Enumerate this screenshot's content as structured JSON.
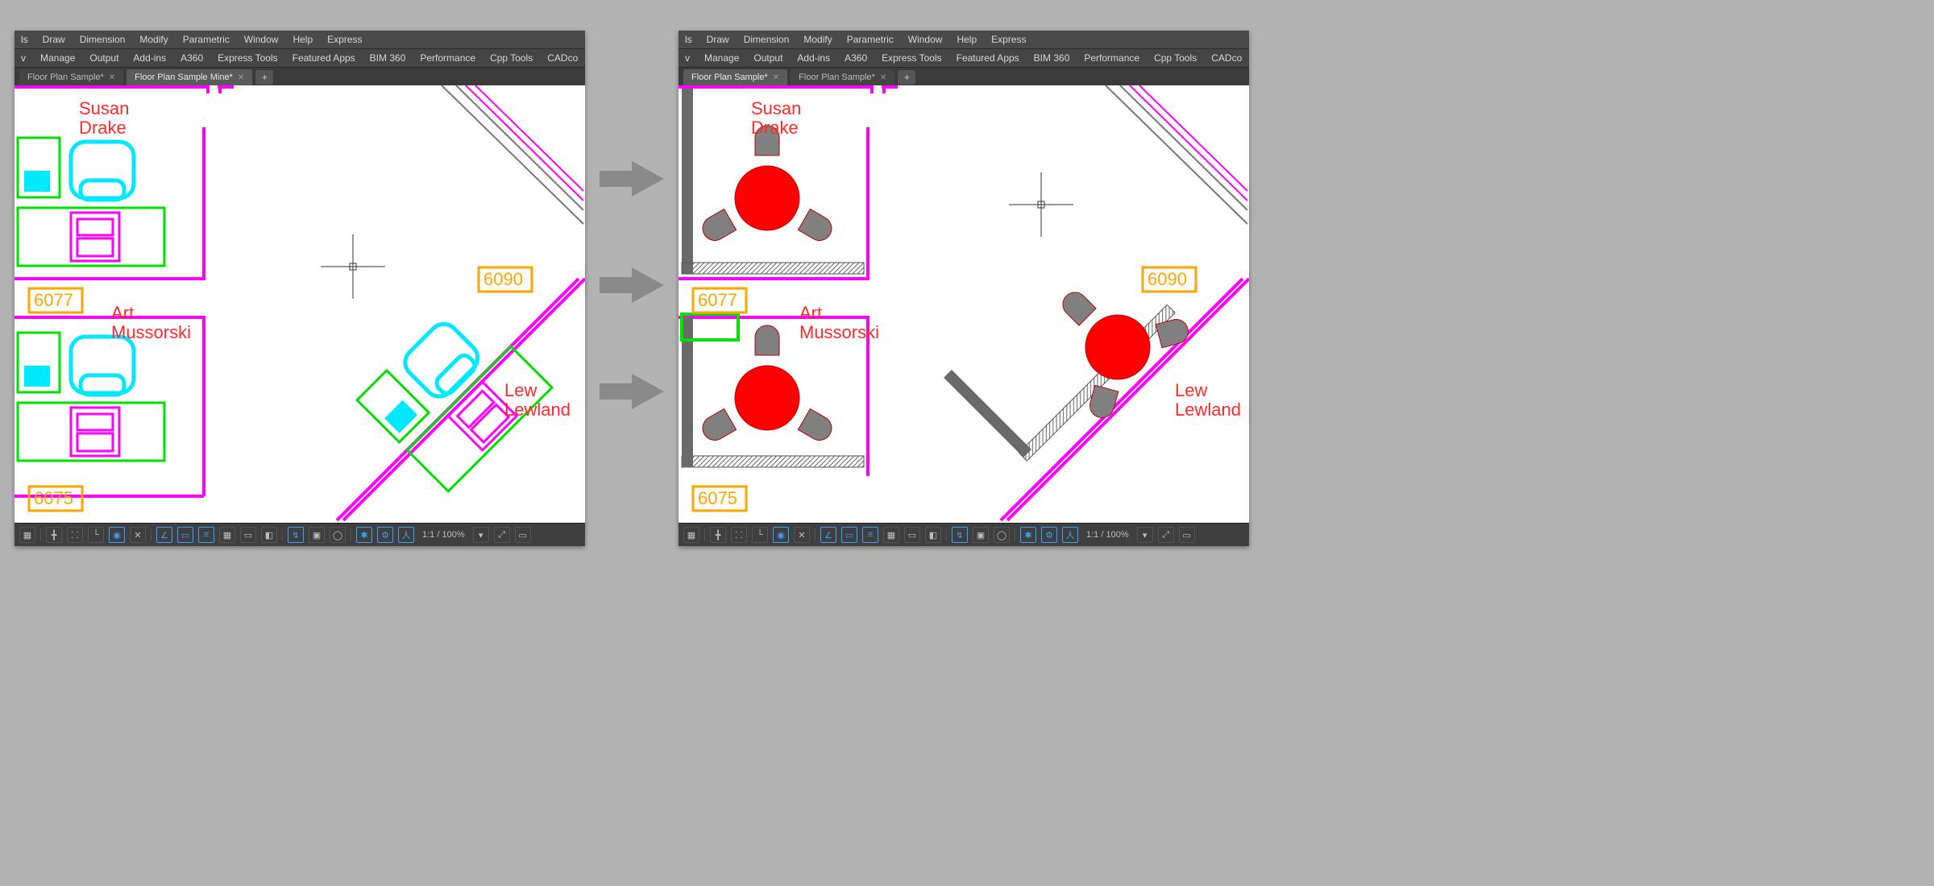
{
  "menus": {
    "top": [
      "ls",
      "Draw",
      "Dimension",
      "Modify",
      "Parametric",
      "Window",
      "Help",
      "Express"
    ],
    "ribbon": [
      "v",
      "Manage",
      "Output",
      "Add-ins",
      "A360",
      "Express Tools",
      "Featured Apps",
      "BIM 360",
      "Performance",
      "Cpp Tools",
      "CADco"
    ]
  },
  "left": {
    "tabs": [
      {
        "label": "Floor Plan Sample*",
        "active": false
      },
      {
        "label": "Floor Plan Sample Mine*",
        "active": true
      }
    ]
  },
  "right": {
    "tabs": [
      {
        "label": "Floor Plan Sample*",
        "active": true
      },
      {
        "label": "Floor Plan Sample*",
        "active": false
      }
    ]
  },
  "labels": {
    "susan1": "Susan",
    "susan2": "Drake",
    "art1": "Art",
    "art2": "Mussorski",
    "lew1": "Lew",
    "lew2": "Lewland",
    "room6077": "6077",
    "room6075": "6075",
    "room6090": "6090"
  },
  "status": {
    "zoom": "1:1 / 100%"
  },
  "colors": {
    "magenta": "#ff00ff",
    "green": "#00e000",
    "cyan": "#00e8ff",
    "orange": "#ffa500",
    "red": "#ff0000",
    "grey": "#808080"
  }
}
